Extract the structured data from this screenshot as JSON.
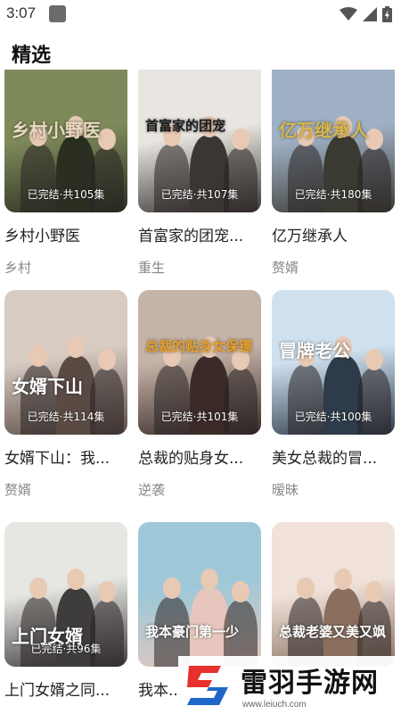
{
  "status_bar": {
    "time": "3:07"
  },
  "header": {
    "title": "精选"
  },
  "dramas": [
    {
      "title": "乡村小野医",
      "tag": "乡村",
      "episodes": "已完结·共105集",
      "poster_text": "乡村小野医",
      "colors": {
        "bg": "#7f8a5a",
        "bg2": "#2a2f22",
        "accent": "#e8d9c0"
      }
    },
    {
      "title": "首富家的团宠...",
      "tag": "重生",
      "episodes": "已完结·共107集",
      "poster_text": "首富家的团宠",
      "colors": {
        "bg": "#e9e6e1",
        "bg2": "#3a3633",
        "accent": "#1a1a1a"
      }
    },
    {
      "title": "亿万继承人",
      "tag": "赘婿",
      "episodes": "已完结·共180集",
      "poster_text": "亿万继承人",
      "colors": {
        "bg": "#9fb0c4",
        "bg2": "#3b3a32",
        "accent": "#d9b64a"
      }
    },
    {
      "title": "女婿下山：我...",
      "tag": "赘婿",
      "episodes": "已完结·共114集",
      "poster_text": "女婿下山",
      "colors": {
        "bg": "#d7cbc2",
        "bg2": "#5a4a44",
        "accent": "#ffffff"
      }
    },
    {
      "title": "总裁的贴身女...",
      "tag": "逆袭",
      "episodes": "已完结·共101集",
      "poster_text": "总裁的贴身女保镖",
      "colors": {
        "bg": "#c4b3a7",
        "bg2": "#3a2a28",
        "accent": "#e7a02a"
      }
    },
    {
      "title": "美女总裁的冒...",
      "tag": "暧昧",
      "episodes": "已完结·共100集",
      "poster_text": "冒牌老公",
      "colors": {
        "bg": "#cfe0ef",
        "bg2": "#2e3b4a",
        "accent": "#ffffff"
      }
    },
    {
      "title": "上门女婿之同...",
      "tag": "",
      "episodes": "已完结·共96集",
      "poster_text": "上门女婿",
      "colors": {
        "bg": "#e6e6e3",
        "bg2": "#3e3d3c",
        "accent": "#ffffff"
      }
    },
    {
      "title": "我本...",
      "tag": "",
      "episodes": "",
      "poster_text": "我本豪门第一少",
      "colors": {
        "bg": "#9ec8d8",
        "bg2": "#e7c6bd",
        "accent": "#ffffff"
      }
    },
    {
      "title": "",
      "tag": "",
      "episodes": "",
      "poster_text": "总裁老婆又美又飒",
      "colors": {
        "bg": "#f0e2da",
        "bg2": "#8a6f5e",
        "accent": "#ffffff"
      }
    }
  ],
  "watermark": {
    "name": "雷羽手游网",
    "url": "www.leiuch.com",
    "colors": {
      "red": "#e5302b",
      "blue": "#1f66c9"
    }
  }
}
